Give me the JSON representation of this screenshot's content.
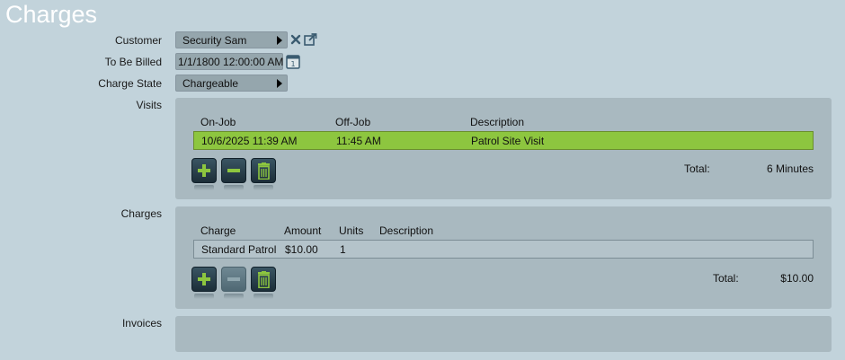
{
  "page": {
    "title": "Charges"
  },
  "form": {
    "customer_label": "Customer",
    "customer_value": "Security Sam",
    "to_be_billed_label": "To Be Billed",
    "to_be_billed_value": "1/1/1800 12:00:00 AM",
    "charge_state_label": "Charge State",
    "charge_state_value": "Chargeable",
    "visits_label": "Visits",
    "charges_label": "Charges",
    "invoices_label": "Invoices"
  },
  "icons": {
    "clear": "close-icon",
    "open": "external-link-icon",
    "calendar": "calendar-icon",
    "add": "plus-icon",
    "remove": "minus-icon",
    "delete": "trash-icon"
  },
  "visits": {
    "headers": [
      "On-Job",
      "Off-Job",
      "Description"
    ],
    "rows": [
      {
        "on_job": "10/6/2025 11:39 AM",
        "off_job": "11:45 AM",
        "description": "Patrol Site Visit",
        "selected": true
      }
    ],
    "total_label": "Total:",
    "total_value": "6 Minutes"
  },
  "charges": {
    "headers": [
      "Charge",
      "Amount",
      "Units",
      "Description"
    ],
    "rows": [
      {
        "charge": "Standard Patrol",
        "amount": "$10.00",
        "units": "1",
        "description": ""
      }
    ],
    "total_label": "Total:",
    "total_value": "$10.00"
  },
  "colors": {
    "background": "#c2d3db",
    "panel": "#a9b9c0",
    "selected_row": "#8dc63f",
    "accent_green": "#8dc63f",
    "button_dark": "#1c2e38"
  }
}
